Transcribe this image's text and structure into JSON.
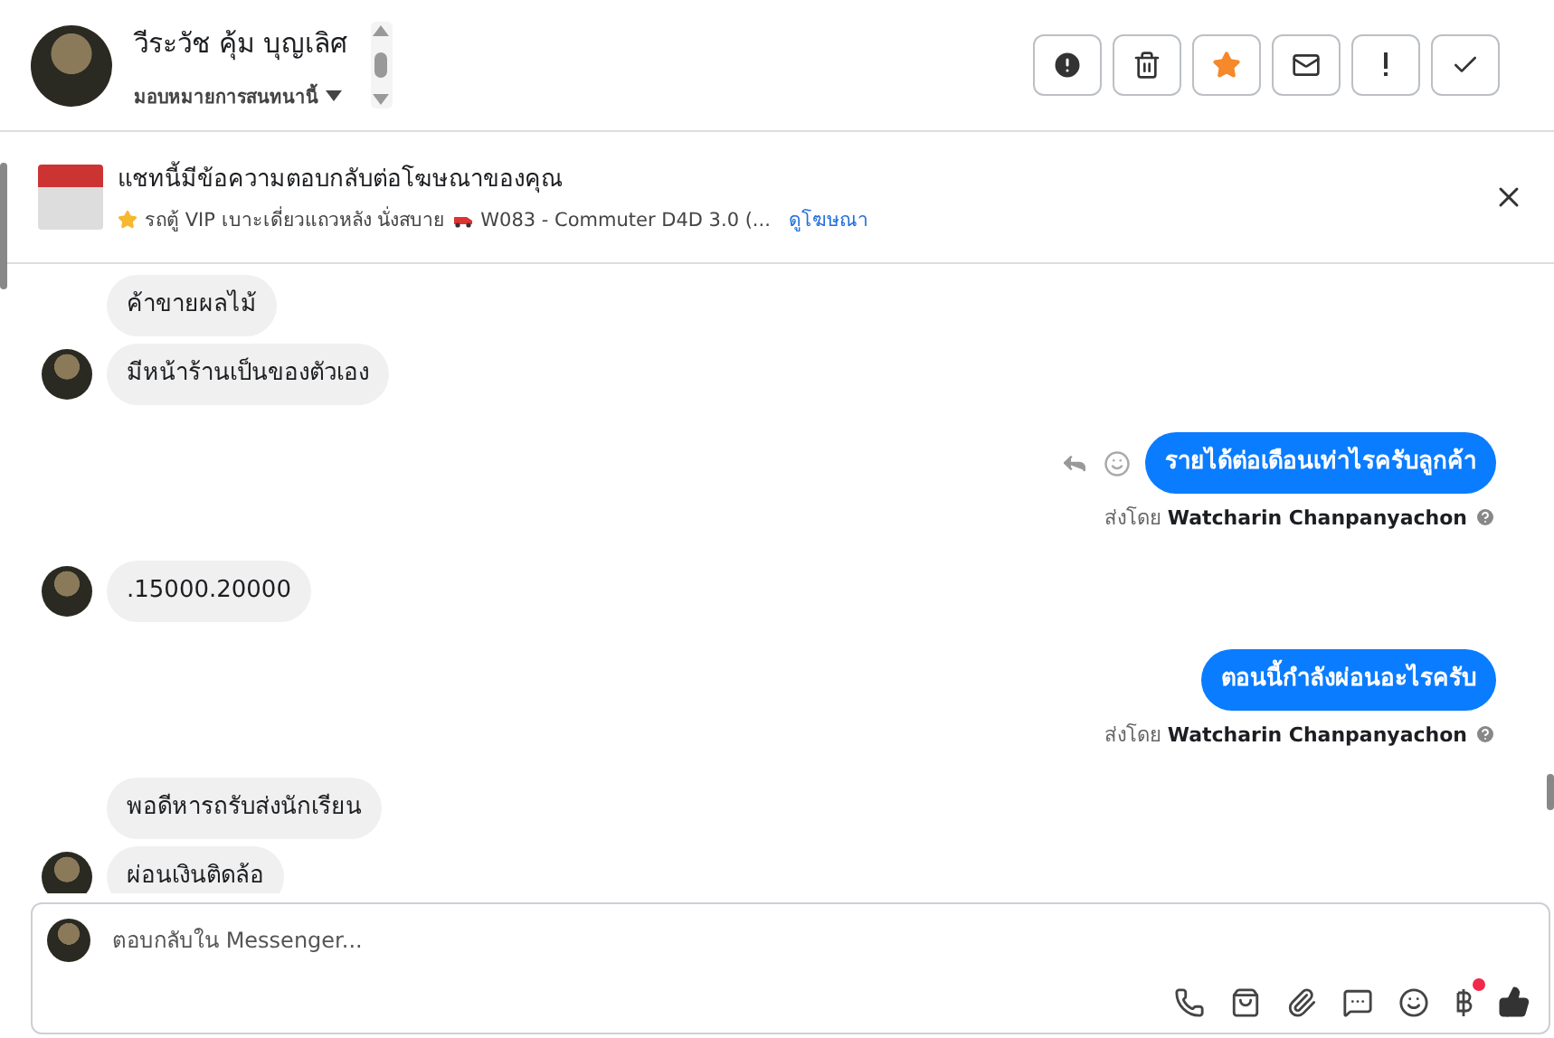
{
  "header": {
    "name": "วีระวัช คุ้ม บุญเลิศ",
    "assign_label": "มอบหมายการสนทนานี้",
    "actions": [
      {
        "kind": "alert"
      },
      {
        "kind": "trash"
      },
      {
        "kind": "star"
      },
      {
        "kind": "mail"
      },
      {
        "kind": "exclaim"
      },
      {
        "kind": "check"
      }
    ]
  },
  "ad_banner": {
    "title": "แชทนี้มีข้อความตอบกลับต่อโฆษณาของคุณ",
    "description": "รถตู้ VIP เบาะเดี่ยวแถวหลัง นั่งสบาย",
    "product": "W083 - Commuter D4D 3.0 (...",
    "link": "ดูโฆษณา"
  },
  "groups": [
    {
      "kind": "incoming",
      "messages": [
        "ค้าขายผลไม้",
        "มีหน้าร้านเป็นของตัวเอง"
      ]
    },
    {
      "kind": "outgoing",
      "messages": [
        "รายได้ต่อเดือนเท่าไรครับลูกค้า"
      ],
      "show_actions": true,
      "sent_by_label": "ส่งโดย",
      "sender": "Watcharin Chanpanyachon"
    },
    {
      "kind": "incoming",
      "messages": [
        ".15000.20000"
      ]
    },
    {
      "kind": "outgoing",
      "messages": [
        "ตอนนี้กำลังผ่อนอะไรครับ"
      ],
      "show_actions": false,
      "sent_by_label": "ส่งโดย",
      "sender": "Watcharin Chanpanyachon"
    },
    {
      "kind": "incoming",
      "messages": [
        "พอดีหารถรับส่งนักเรียน",
        "ผ่อนเงินติดล้อ"
      ]
    }
  ],
  "composer": {
    "placeholder": "ตอบกลับใน Messenger...",
    "tools": [
      {
        "kind": "call",
        "notify": false
      },
      {
        "kind": "bag",
        "notify": false
      },
      {
        "kind": "clip",
        "notify": false
      },
      {
        "kind": "chat",
        "notify": false
      },
      {
        "kind": "emoji",
        "notify": false
      },
      {
        "kind": "baht",
        "notify": true
      },
      {
        "kind": "like",
        "notify": false
      }
    ]
  }
}
